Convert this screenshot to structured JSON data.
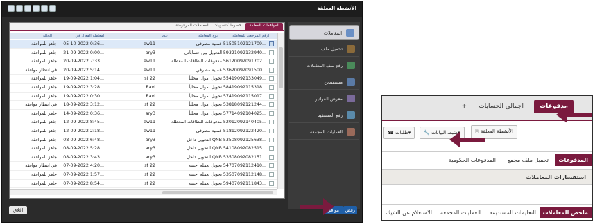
{
  "left_window": {
    "title": "الأنشطة المعلقة",
    "sidebar": [
      {
        "label": "المعاملات",
        "icon": "transactions-icon",
        "active": true
      },
      {
        "label": "تحميل ملف",
        "icon": "upload-file-icon",
        "active": false
      },
      {
        "label": "رفع ملف المعاملات",
        "icon": "upload-transactions-icon",
        "active": false
      },
      {
        "label": "مستفيدين",
        "icon": "beneficiaries-icon",
        "active": false
      },
      {
        "label": "معرض الفواتير",
        "icon": "invoices-icon",
        "active": false
      },
      {
        "label": "رفع المستفيد",
        "icon": "upload-beneficiary-icon",
        "active": false
      },
      {
        "label": "العمليات المجمعة",
        "icon": "bulk-operations-icon",
        "active": false
      }
    ],
    "tabs": [
      {
        "label": "الموافقات المعلقة",
        "active": true
      },
      {
        "label": "خطوط كتسويات",
        "active": false
      },
      {
        "label": "المعاملات المرفوضة",
        "active": false
      }
    ],
    "columns": [
      "الرقم المرجعي للمعاملة",
      "نوع المعاملة",
      "عدد",
      "المعاملة الفعال في",
      "الحالة"
    ],
    "rows": [
      {
        "ref": "51505102121709...",
        "type": "عملية مصرفي",
        "count": "ew11",
        "date": "05-10-2022 0:36...",
        "status": "جاهز للموافقة",
        "selected": true
      },
      {
        "ref": "59321092132940...",
        "type": "التحويل بين حساباتي",
        "count": "ary3",
        "date": "21-09-2022 0:00...",
        "status": "جاهز للموافقة",
        "selected": false
      },
      {
        "ref": "56120092091702...",
        "type": "مدفوعات البطاقات المعطلة",
        "count": "ew11",
        "date": "20-09-2022 7:33...",
        "status": "جاهز للموافقة",
        "selected": false
      },
      {
        "ref": "53620092091500...",
        "type": "عملية مصرفي",
        "count": "ew11",
        "date": "20-09-2022 5:14...",
        "status": "في انتظار موافقة",
        "selected": false
      },
      {
        "ref": "55419092133049...",
        "type": "تحويل أموال محلياً",
        "count": "st 22",
        "date": "19-09-2022 1:04...",
        "status": "جاهز للموافقة",
        "selected": false
      },
      {
        "ref": "58419092115318...",
        "type": "تحويل أموال محلياً",
        "count": "Ravi",
        "date": "19-09-2022 3:28...",
        "status": "جاهز للموافقة",
        "selected": false
      },
      {
        "ref": "57419092115017...",
        "type": "تحويل أموال محلياً",
        "count": "Ravi",
        "date": "19-09-2022 0:30...",
        "status": "جاهز للموافقة",
        "selected": false
      },
      {
        "ref": "53818092121244...",
        "type": "تحويل أموال محلياً",
        "count": "st 22",
        "date": "18-09-2022 3:12...",
        "status": "في انتظار موافقة",
        "selected": false
      },
      {
        "ref": "57714092104025...",
        "type": "تحويل أموال محلياً",
        "count": "ary3",
        "date": "14-09-2022 0:36...",
        "status": "جاهز للموافقة",
        "selected": false
      },
      {
        "ref": "52012092140405...",
        "type": "مدفوعات البطاقات المعطلة",
        "count": "ew11",
        "date": "12-09-2022 8:45...",
        "status": "جاهز للموافقة",
        "selected": false
      },
      {
        "ref": "51812092122420...",
        "type": "عملية مصرفي",
        "count": "ew11",
        "date": "12-09-2022 2:18...",
        "status": "جاهز للموافقة",
        "selected": false
      },
      {
        "ref": "53508092125638...",
        "type": "التحويل داخل QNB",
        "count": "ary3",
        "date": "08-09-2022 6:48...",
        "status": "جاهز للموافقة",
        "selected": false
      },
      {
        "ref": "54108092082515...",
        "type": "التحويل داخل QNB",
        "count": "ary3",
        "date": "08-09-2022 5:28...",
        "status": "جاهز للموافقة",
        "selected": false
      },
      {
        "ref": "53508092082151...",
        "type": "التحويل داخل QNB",
        "count": "ary3",
        "date": "08-09-2022 3:43...",
        "status": "جاهز للموافقة",
        "selected": false
      },
      {
        "ref": "54707092112410...",
        "type": "تحويل بعملة أجنبية",
        "count": "st 22",
        "date": "07-09-2022 4:20...",
        "status": "في انتظار موافقة",
        "selected": false
      },
      {
        "ref": "53507092112148...",
        "type": "تحويل بعملة أجنبية",
        "count": "st 22",
        "date": "07-09-2022 1:57...",
        "status": "جاهز للموافقة",
        "selected": false
      },
      {
        "ref": "59407092111843...",
        "type": "تحويل بعملة أجنبية",
        "count": "st 22",
        "date": "07-09-2022 8:54...",
        "status": "جاهز للموافقة",
        "selected": false
      }
    ],
    "footer": {
      "approve": "موافق",
      "reject": "رفض",
      "close": "اغلاق"
    }
  },
  "right_window": {
    "tabs": [
      {
        "label": "مدفوعات",
        "active": true
      },
      {
        "label": "اجمالي الحسابات",
        "active": false
      },
      {
        "label": "+",
        "active": false
      }
    ],
    "toolbar": [
      {
        "label": "طلبات",
        "icon": "requests-icon"
      },
      {
        "label": "ضبط البيانات",
        "icon": "settings-wrench-icon"
      },
      {
        "label": "الأنشطة المعلقة",
        "icon": "pending-activities-icon"
      }
    ],
    "submenu": [
      {
        "label": "المدفوعات",
        "active": true
      },
      {
        "label": "تحميل ملف مجمع",
        "active": false
      },
      {
        "label": "المدفوعات الحكومية",
        "active": false
      }
    ],
    "inquiries": "استفسارات المعاملات",
    "nav": [
      {
        "label": "ملخص المعاملات",
        "active": true
      },
      {
        "label": "التعليمات المستديمة",
        "active": false
      },
      {
        "label": "العمليات المجمعة",
        "active": false
      },
      {
        "label": "الاستعلام عن الشيك",
        "active": false
      }
    ]
  },
  "colors": {
    "accent": "#7a1a3e",
    "window_dark": "#2b2b2b",
    "grid_header": "#dde6f3",
    "button_blue": "#1f5fa8"
  }
}
